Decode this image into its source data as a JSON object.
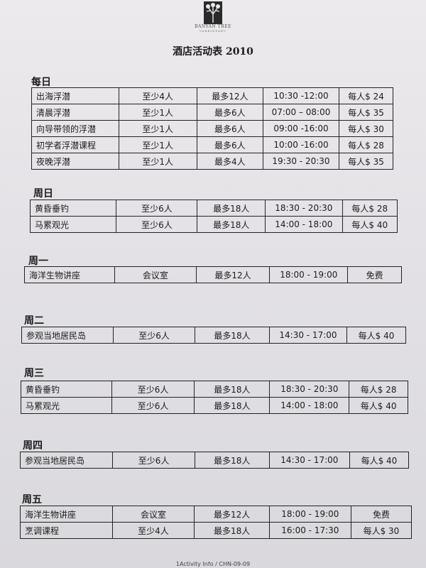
{
  "header": {
    "brand_name": "BANYAN TREE",
    "brand_location": "VABBINFARU",
    "title": "酒店活动表 2010"
  },
  "schedule": [
    {
      "day": "每日",
      "rows": [
        [
          "出海浮潜",
          "至少4人",
          "最多12人",
          "10:30 -12:00",
          "每人$ 24"
        ],
        [
          "清晨浮潜",
          "至少1人",
          "最多6人",
          "07:00 – 08:00",
          "每人$ 35"
        ],
        [
          "向导带领的浮潜",
          "至少1人",
          "最多6人",
          "09:00 -16:00",
          "每人$ 30"
        ],
        [
          "初学者浮潜课程",
          "至少1人",
          "最多6人",
          "10:00 -16:00",
          "每人$ 28"
        ],
        [
          "夜晚浮潜",
          "至少1人",
          "最多4人",
          "19:30 - 20:30",
          "每人$ 35"
        ]
      ]
    },
    {
      "day": "周日",
      "rows": [
        [
          "黄昏垂钓",
          "至少6人",
          "最多18人",
          "18:30 - 20:30",
          "每人$ 28"
        ],
        [
          "马累观光",
          "至少6人",
          "最多18人",
          "14:00 - 18:00",
          "每人$ 40"
        ]
      ]
    },
    {
      "day": "周一",
      "rows": [
        [
          "海洋生物讲座",
          "会议室",
          "最多12人",
          "18:00 - 19:00",
          "免费"
        ]
      ]
    },
    {
      "day": "周二",
      "rows": [
        [
          "参观当地居民岛",
          "至少6人",
          "最多18人",
          "14:30 - 17:00",
          "每人$ 40"
        ]
      ]
    },
    {
      "day": "周三",
      "rows": [
        [
          "黄昏垂钓",
          "至少6人",
          "最多18人",
          "18:30 - 20:30",
          "每人$ 28"
        ],
        [
          "马累观光",
          "至少6人",
          "最多18人",
          "14:00 - 18:00",
          "每人$ 40"
        ]
      ]
    },
    {
      "day": "周四",
      "rows": [
        [
          "参观当地居民岛",
          "至少6人",
          "最多18人",
          "14:30 - 17:00",
          "每人$ 40"
        ]
      ]
    },
    {
      "day": "周五",
      "rows": [
        [
          "海洋生物讲座",
          "会议室",
          "最多12人",
          "18:00 - 19:00",
          "免费"
        ],
        [
          "烹调课程",
          "至少4人",
          "最多18人",
          "16:00 - 17:30",
          "每人$ 30"
        ]
      ]
    }
  ],
  "footer": {
    "text": "1Activity Info / CHN-09-09"
  }
}
